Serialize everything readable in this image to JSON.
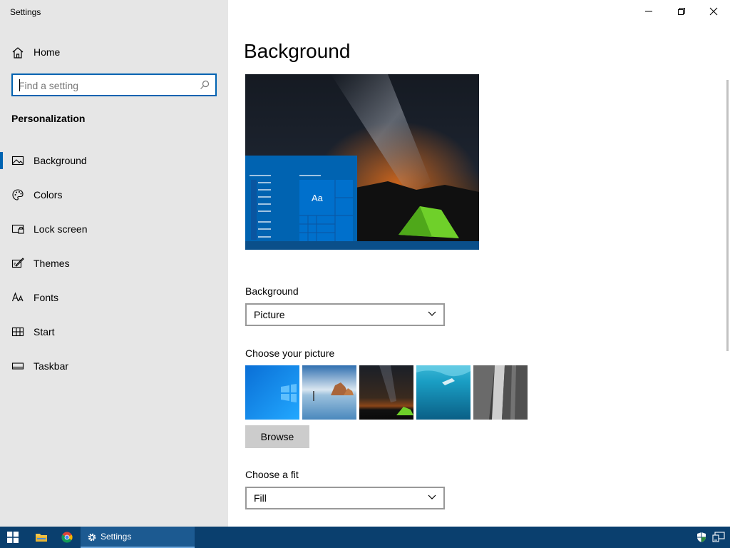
{
  "window": {
    "title": "Settings"
  },
  "sidebar": {
    "home_label": "Home",
    "search_placeholder": "Find a setting",
    "section_title": "Personalization",
    "items": [
      {
        "label": "Background",
        "icon": "picture-icon",
        "active": true
      },
      {
        "label": "Colors",
        "icon": "palette-icon",
        "active": false
      },
      {
        "label": "Lock screen",
        "icon": "lock-screen-icon",
        "active": false
      },
      {
        "label": "Themes",
        "icon": "themes-icon",
        "active": false
      },
      {
        "label": "Fonts",
        "icon": "fonts-icon",
        "active": false
      },
      {
        "label": "Start",
        "icon": "start-icon",
        "active": false
      },
      {
        "label": "Taskbar",
        "icon": "taskbar-icon",
        "active": false
      }
    ]
  },
  "main": {
    "title": "Background",
    "preview_sample_text": "Aa",
    "background_label": "Background",
    "background_value": "Picture",
    "choose_picture_label": "Choose your picture",
    "browse_label": "Browse",
    "fit_label": "Choose a fit",
    "fit_value": "Fill"
  },
  "taskbar": {
    "active_app_label": "Settings"
  },
  "colors": {
    "accent": "#0063b1",
    "sidebar_bg": "#e6e6e6",
    "taskbar_bg": "#0a3f6e"
  }
}
